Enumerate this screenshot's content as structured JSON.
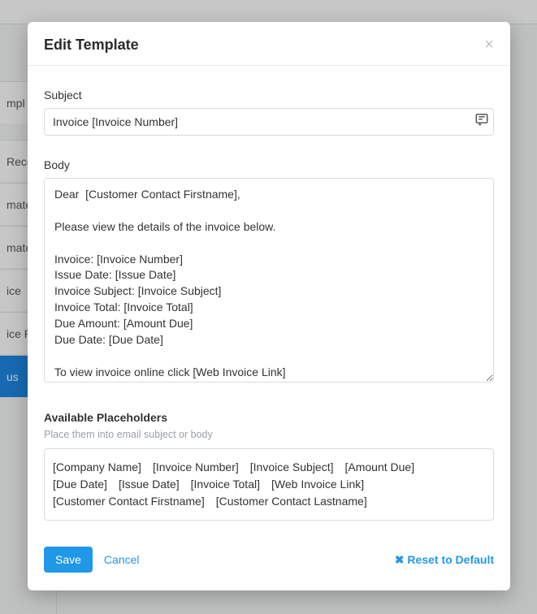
{
  "background": {
    "rows": [
      "mpl",
      "Recei",
      "mate",
      "mate",
      "ice",
      "ice R",
      "us"
    ],
    "activeIndex": 6
  },
  "modal": {
    "title": "Edit Template",
    "subject": {
      "label": "Subject",
      "value": "Invoice [Invoice Number]"
    },
    "body": {
      "label": "Body",
      "value": "Dear  [Customer Contact Firstname],\n\nPlease view the details of the invoice below.\n\nInvoice: [Invoice Number]\nIssue Date: [Issue Date]\nInvoice Subject: [Invoice Subject]\nInvoice Total: [Invoice Total]\nDue Amount: [Amount Due]\nDue Date: [Due Date]\n\nTo view invoice online click [Web Invoice Link]"
    },
    "placeholders": {
      "title": "Available Placeholders",
      "hint": "Place them into email subject or body",
      "items": [
        "[Company Name]",
        "[Invoice Number]",
        "[Invoice Subject]",
        "[Amount Due]",
        "[Due Date]",
        "[Issue Date]",
        "[Invoice Total]",
        "[Web Invoice Link]",
        "[Customer Contact Firstname]",
        "[Customer Contact Lastname]"
      ]
    },
    "buttons": {
      "save": "Save",
      "cancel": "Cancel",
      "reset": "Reset to Default"
    }
  }
}
